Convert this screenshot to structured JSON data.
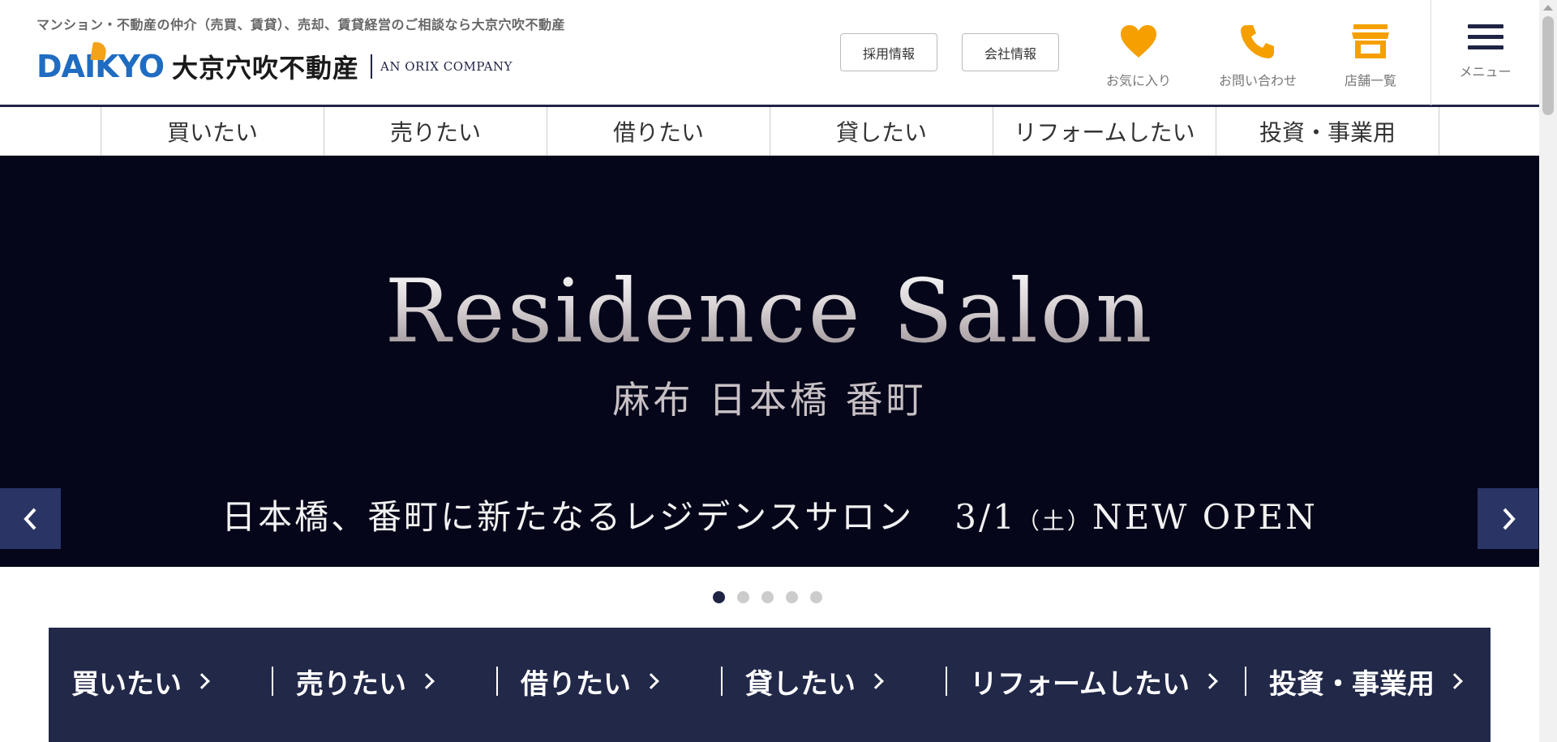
{
  "header": {
    "tagline": "マンション・不動産の仲介（売買、賃貸）、売却、賃貸経営のご相談なら大京穴吹不動産",
    "logo": {
      "brand": "DAIKYO",
      "name_jp": "大京穴吹不動産",
      "group": "AN ORIX COMPANY"
    },
    "buttons": {
      "recruit": "採用情報",
      "company": "会社情報"
    },
    "icons": {
      "favorites": {
        "label": "お気に入り",
        "icon": "heart-icon"
      },
      "contact": {
        "label": "お問い合わせ",
        "icon": "phone-icon"
      },
      "shops": {
        "label": "店舗一覧",
        "icon": "store-icon"
      },
      "menu": {
        "label": "メニュー",
        "icon": "hamburger-icon"
      }
    },
    "colors": {
      "accent": "#f5a000",
      "navy": "#1f2445",
      "brand_blue": "#1f6cc2"
    }
  },
  "topnav": {
    "items": [
      {
        "label": "買いたい"
      },
      {
        "label": "売りたい"
      },
      {
        "label": "借りたい"
      },
      {
        "label": "貸したい"
      },
      {
        "label": "リフォームしたい"
      },
      {
        "label": "投資・事業用"
      }
    ]
  },
  "hero": {
    "title": "Residence Salon",
    "locations": "麻布 日本橋 番町",
    "caption": "日本橋、番町に新たなるレジデンスサロン",
    "date": "3/1",
    "dow": "（土）",
    "badge": "NEW OPEN",
    "slide_count": 5,
    "active_slide": 1
  },
  "category_bar": {
    "items": [
      {
        "label": "買いたい"
      },
      {
        "label": "売りたい"
      },
      {
        "label": "借りたい"
      },
      {
        "label": "貸したい"
      },
      {
        "label": "リフォームしたい"
      },
      {
        "label": "投資・事業用"
      }
    ]
  }
}
